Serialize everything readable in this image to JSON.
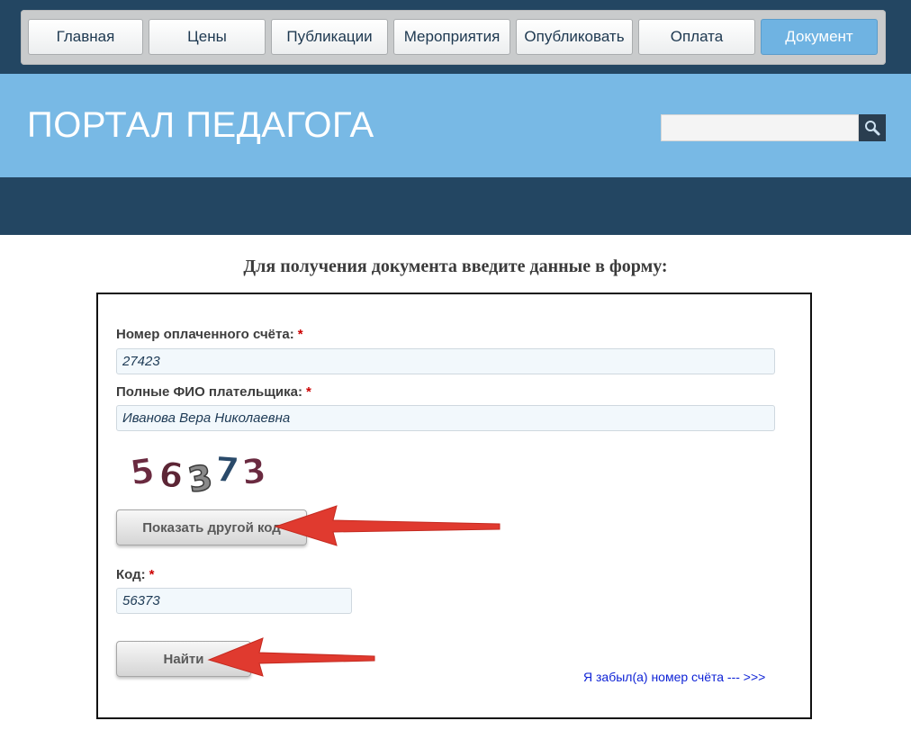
{
  "nav": {
    "items": [
      {
        "label": "Главная"
      },
      {
        "label": "Цены"
      },
      {
        "label": "Публикации"
      },
      {
        "label": "Мероприятия"
      },
      {
        "label": "Опубликовать"
      },
      {
        "label": "Оплата"
      },
      {
        "label": "Документ",
        "active": true
      }
    ]
  },
  "header": {
    "site_title": "ПОРТАЛ ПЕДАГОГА",
    "search_value": "",
    "search_icon": "search-icon"
  },
  "form": {
    "heading": "Для получения документа введите данные в форму:",
    "invoice_label": "Номер оплаченного счёта:",
    "invoice_value": "27423",
    "name_label": "Полные ФИО плательщика:",
    "name_value": "Иванова Вера Николаевна",
    "required_mark": "*",
    "captcha_digits": "56373",
    "refresh_button": "Показать другой код",
    "code_label": "Код:",
    "code_value": "56373",
    "submit_button": "Найти",
    "forgot_link": "Я забыл(а) номер счёта --- >>>"
  },
  "colors": {
    "nav_dark": "#234662",
    "banner_blue": "#78b9e5",
    "active_tab": "#6fb3e2",
    "required": "#cc0000",
    "link": "#0f23d6",
    "annotation_arrow": "#e03a2f"
  }
}
